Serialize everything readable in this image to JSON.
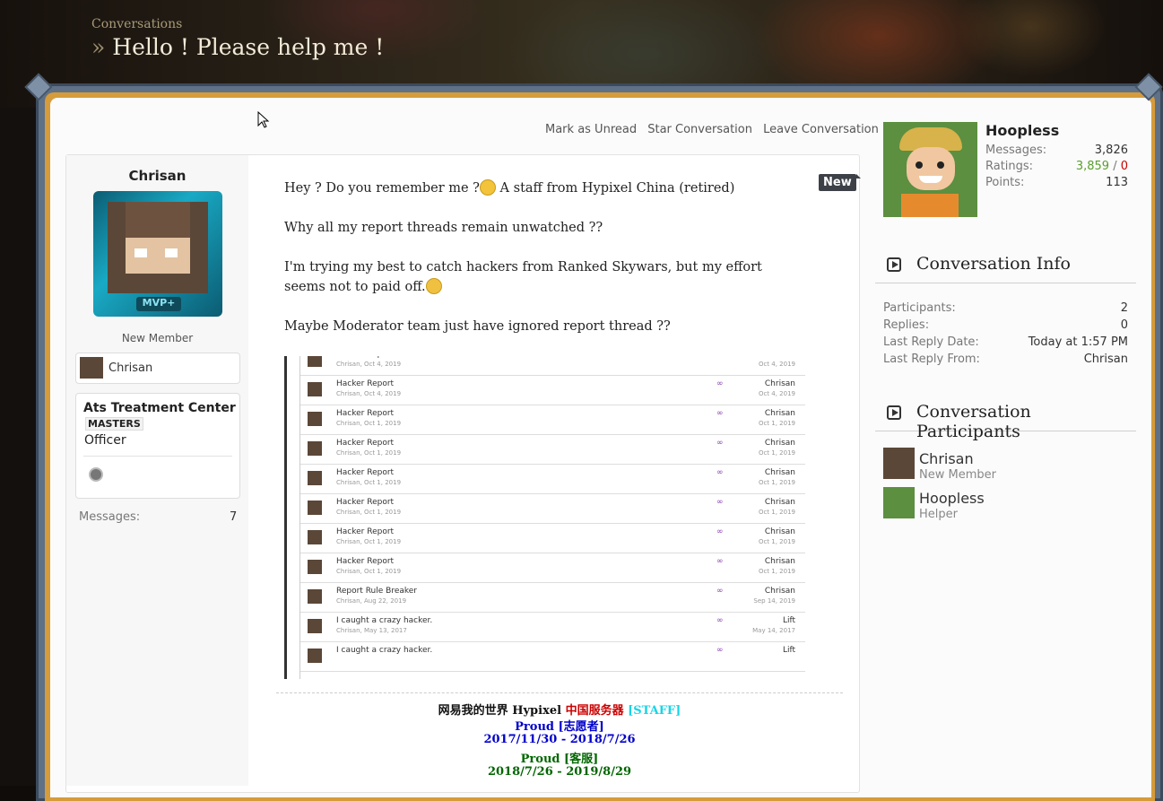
{
  "header": {
    "breadcrumb": "Conversations",
    "raquo": "»",
    "title": "Hello ! Please help me !"
  },
  "actions": [
    "Mark as Unread",
    "Star Conversation",
    "Leave Conversation"
  ],
  "author": {
    "name": "Chrisan",
    "rank_badge": "MVP+",
    "role": "New Member",
    "linked_account": "Chrisan",
    "guild_name": "Ats Treatment Center",
    "guild_tag": "MASTERS",
    "guild_rank": "Officer",
    "messages_label": "Messages:",
    "messages_value": "7"
  },
  "post": {
    "new_label": "New",
    "line1_a": "Hey ? Do you remember me ?",
    "line1_b": " A staff from Hypixel China (retired)",
    "line2": "Why all my report threads remain unwatched ??",
    "line3": "I'm trying my best to catch hackers from Ranked Skywars, but my effort seems not to paid off.",
    "line4": "Maybe Moderator team just have ignored report thread ??"
  },
  "screenshot_rows": [
    {
      "title": "Hacker Report",
      "sub": "Chrisan, Oct 4, 2019",
      "user": "Chrisan",
      "date": "Oct 4, 2019"
    },
    {
      "title": "Hacker Report",
      "sub": "Chrisan, Oct 4, 2019",
      "user": "Chrisan",
      "date": "Oct 4, 2019"
    },
    {
      "title": "Hacker Report",
      "sub": "Chrisan, Oct 1, 2019",
      "user": "Chrisan",
      "date": "Oct 1, 2019"
    },
    {
      "title": "Hacker Report",
      "sub": "Chrisan, Oct 1, 2019",
      "user": "Chrisan",
      "date": "Oct 1, 2019"
    },
    {
      "title": "Hacker Report",
      "sub": "Chrisan, Oct 1, 2019",
      "user": "Chrisan",
      "date": "Oct 1, 2019"
    },
    {
      "title": "Hacker Report",
      "sub": "Chrisan, Oct 1, 2019",
      "user": "Chrisan",
      "date": "Oct 1, 2019"
    },
    {
      "title": "Hacker Report",
      "sub": "Chrisan, Oct 1, 2019",
      "user": "Chrisan",
      "date": "Oct 1, 2019"
    },
    {
      "title": "Hacker Report",
      "sub": "Chrisan, Oct 1, 2019",
      "user": "Chrisan",
      "date": "Oct 1, 2019"
    },
    {
      "title": "Report Rule Breaker",
      "sub": "Chrisan, Aug 22, 2019",
      "user": "Chrisan",
      "date": "Sep 14, 2019"
    },
    {
      "title": "I caught a crazy hacker.",
      "sub": "Chrisan, May 13, 2017",
      "user": "Lift",
      "date": "May 14, 2017"
    },
    {
      "title": "I caught a crazy hacker.",
      "sub": "",
      "user": "Lift",
      "date": ""
    }
  ],
  "signature": {
    "l1_a": "网易我的世界 Hypixel ",
    "l1_b": "中国服务器",
    "l1_c": " [STAFF]",
    "l2": "Proud [志愿者]",
    "l3": "2017/11/30 - 2018/7/26",
    "l4": "Proud [客服]",
    "l5": "2018/7/26 - 2019/8/29"
  },
  "sidebar": {
    "profile": {
      "name": "Hoopless",
      "messages_label": "Messages:",
      "messages": "3,826",
      "ratings_label": "Ratings:",
      "ratings_pos": "3,859",
      "ratings_sep": " / ",
      "ratings_neg": "0",
      "points_label": "Points:",
      "points": "113"
    },
    "info": {
      "heading": "Conversation Info",
      "rows": [
        {
          "label": "Participants:",
          "value": "2"
        },
        {
          "label": "Replies:",
          "value": "0"
        },
        {
          "label": "Last Reply Date:",
          "value": "Today at 1:57 PM"
        },
        {
          "label": "Last Reply From:",
          "value": "Chrisan"
        }
      ]
    },
    "participants": {
      "heading": "Conversation Participants",
      "list": [
        {
          "name": "Chrisan",
          "role": "New Member"
        },
        {
          "name": "Hoopless",
          "role": "Helper"
        }
      ]
    }
  },
  "colors": {
    "frame_gold": "#d69b3a",
    "sig_red": "#cc0000",
    "sig_cyan": "#19d4e6",
    "sig_blue": "#0000cc",
    "sig_green": "#006600",
    "rating_pos": "#5aa02c",
    "rating_neg": "#cc0000"
  }
}
